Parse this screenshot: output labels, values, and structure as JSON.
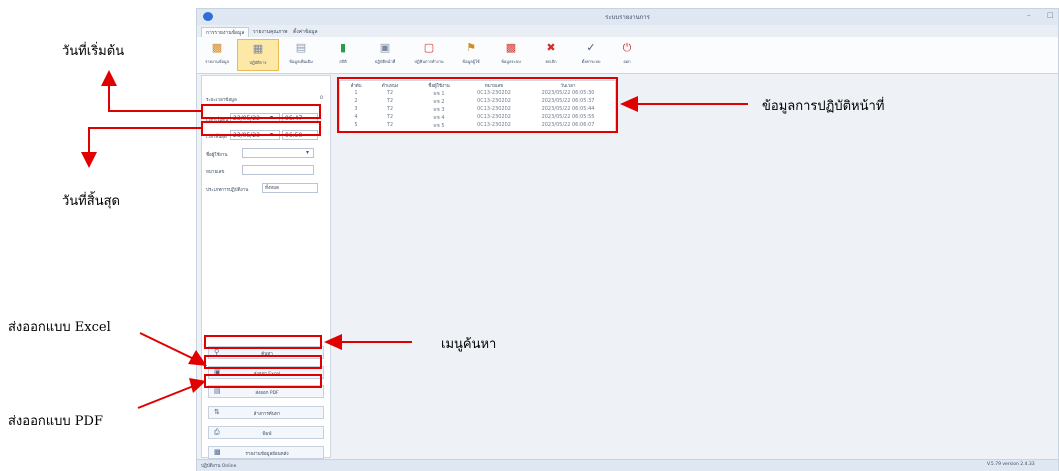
{
  "window": {
    "title": "ระบบรายงานการ",
    "version": "V.5.79 version 2.4.33",
    "status": "ปฏิบัติงาน Online"
  },
  "tabs": [
    "การรายงานข้อมูล",
    "รายงานคุณภาพ",
    "ตั้งค่าข้อมูล"
  ],
  "ribbon": [
    {
      "label": "รายงานข้อมูล",
      "icon": "person-icon",
      "color": "#d18b2a"
    },
    {
      "label": "ปฏิบัติการ",
      "icon": "timeline-icon",
      "color": "#8a9ab0",
      "active": true
    },
    {
      "label": "ข้อมูลเพิ่มเติม",
      "icon": "doc-icon",
      "color": "#8a9ab0"
    },
    {
      "label": "สถิติ",
      "icon": "bar-chart-icon",
      "color": "#2e9a45"
    },
    {
      "label": "ปฏิบัติหน้าที่",
      "icon": "doc-chart-icon",
      "color": "#7c8aa0"
    },
    {
      "label": "ปฏิทินการทำงาน",
      "icon": "calendar-icon",
      "color": "#d23a2f"
    },
    {
      "label": "ข้อมูลผู้ใช้",
      "icon": "flag-icon",
      "color": "#d18b2a"
    },
    {
      "label": "ข้อมูลระบบ",
      "icon": "chart-doc-icon",
      "color": "#d23a2f"
    },
    {
      "label": "ยกเลิก",
      "icon": "cancel-icon",
      "color": "#d0312d"
    },
    {
      "label": "ตั้งค่าระบบ",
      "icon": "check-icon",
      "color": "#4a5b74"
    },
    {
      "label": "ออก",
      "icon": "power-icon",
      "color": "#d0312d"
    }
  ],
  "left_panel": {
    "header_label": "ระยะเวลาข้อมูล",
    "header_value": "0",
    "start_label": "เวลาเริ่มต้น",
    "start_date": "23/05/22",
    "start_time": "06:47",
    "end_label": "เวลาสิ้นสุด",
    "end_date": "23/05/23",
    "end_time": "06:50",
    "filter1_label": "ชื่อผู้ใช้งาน",
    "filter2_label": "หมายเลข",
    "filter3_label": "ประเภทการปฏิบัติงาน",
    "filter3_value": "ทั้งหมด",
    "buttons": [
      {
        "label": "ค้นหา",
        "icon": "search-icon"
      },
      {
        "label": "ส่งออก Excel",
        "icon": "excel-icon"
      },
      {
        "label": "ส่งออก PDF",
        "icon": "pdf-icon"
      },
      {
        "label": "ล้างการค้นหา",
        "icon": "sync-icon"
      },
      {
        "label": "พิมพ์",
        "icon": "print-icon"
      },
      {
        "label": "รายงานข้อมูลย้อนหลัง",
        "icon": "report-icon"
      }
    ]
  },
  "grid": {
    "headers": [
      "ลำดับ",
      "ตำแหน่ง",
      "ชื่อผู้ใช้งาน",
      "หมายเลข",
      "วันเวลา"
    ],
    "rows": [
      [
        "1",
        "T2",
        "ผช 1",
        "0C13-230202",
        "2023/05/22 06:05:30"
      ],
      [
        "2",
        "T2",
        "ผช 2",
        "0C13-230202",
        "2023/05/22 06:05:37"
      ],
      [
        "3",
        "T2",
        "ผช 3",
        "0C13-230202",
        "2023/05/22 06:05:44"
      ],
      [
        "4",
        "T2",
        "ผช 4",
        "0C13-230202",
        "2023/05/22 06:05:55"
      ],
      [
        "5",
        "T2",
        "ผช 5",
        "0C13-230202",
        "2023/05/22 06:06:07"
      ]
    ]
  },
  "annotations": {
    "start_date": "วันที่เริ่มต้น",
    "end_date": "วันที่สิ้นสุด",
    "duty_data": "ข้อมูลการปฏิบัติหน้าที่",
    "search_menu": "เมนูค้นหา",
    "export_excel": "ส่งออกแบบ Excel",
    "export_pdf": "ส่งออกแบบ PDF"
  }
}
